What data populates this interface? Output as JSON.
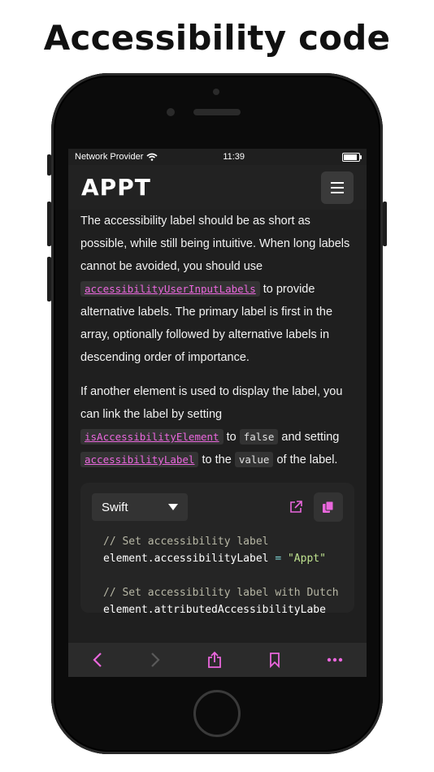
{
  "headline": "Accessibility code",
  "status_bar": {
    "carrier": "Network Provider",
    "time": "11:39",
    "battery_level": 1.0
  },
  "header": {
    "logo": "APPT"
  },
  "content": {
    "p1_a": "The accessibility label should be as short as possible, while still being intuitive. When long labels cannot be avoided, you should use ",
    "p1_code": "accessibilityUserInputLabels",
    "p1_b": " to provide alternative labels. The primary label is first in the array, optionally followed by alternative labels in descending order of importance.",
    "p2_a": "If another element is used to display the label, you can link the label by setting ",
    "p2_code1": "isAccessibilityElement",
    "p2_b": " to ",
    "p2_code2": "false",
    "p2_c": " and setting ",
    "p2_code3": "accessibilityLabel",
    "p2_d": " to the ",
    "p2_code4": "value",
    "p2_e": " of the label."
  },
  "code_card": {
    "language": "Swift",
    "lines": {
      "l1": "// Set accessibility label",
      "l2_a": "element.accessibilityLabel ",
      "l2_op": "=",
      "l2_str": " \"Appt\"",
      "l3": "// Set accessibility label with Dutch sp",
      "l4": "element.attributedAccessibilityLabe"
    }
  },
  "colors": {
    "accent": "#ea67dd",
    "background": "#1f1f1f",
    "surface": "#252525"
  },
  "icons": [
    "wifi-icon",
    "battery-icon",
    "hamburger-menu-icon",
    "chevron-down-icon",
    "external-link-icon",
    "copy-icon",
    "back-icon",
    "forward-icon",
    "share-icon",
    "bookmark-icon",
    "more-icon"
  ]
}
